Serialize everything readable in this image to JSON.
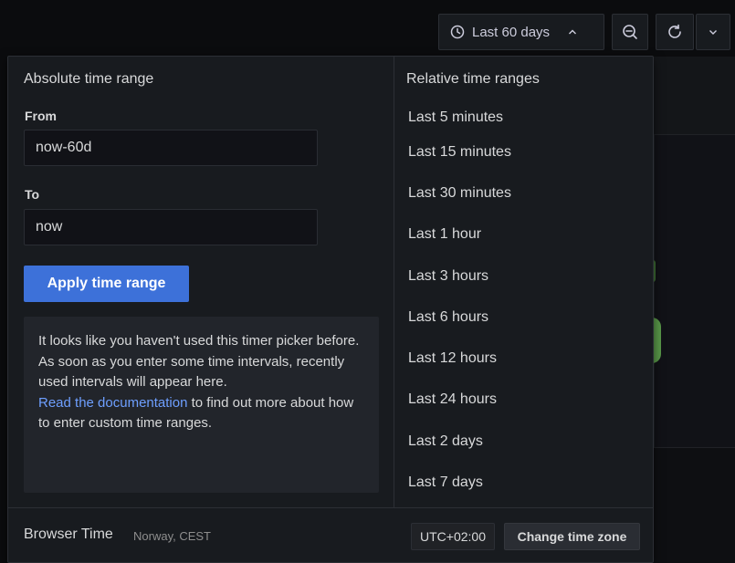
{
  "toolbar": {
    "time_range_label": "Last 60 days",
    "icons": {
      "clock": "clock-icon",
      "caret": "chevron-up-icon",
      "zoom": "zoom-out-icon",
      "refresh": "refresh-icon",
      "refresh_more": "chevron-down-icon"
    }
  },
  "absolute": {
    "title": "Absolute time range",
    "from_label": "From",
    "from_value": "now-60d",
    "to_label": "To",
    "to_value": "now",
    "apply_label": "Apply time range"
  },
  "info": {
    "text": "It looks like you haven't used this timer picker before. As soon as you enter some time intervals, recently used intervals will appear here.",
    "link_text": "Read the documentation",
    "link_suffix": " to find out more about how to enter custom time ranges."
  },
  "relative": {
    "title": "Relative time ranges",
    "items": [
      "Last 5 minutes",
      "Last 15 minutes",
      "Last 30 minutes",
      "Last 1 hour",
      "Last 3 hours",
      "Last 6 hours",
      "Last 12 hours",
      "Last 24 hours",
      "Last 2 days",
      "Last 7 days"
    ]
  },
  "footer": {
    "tz_name": "Browser Time",
    "tz_region": "Norway, CEST",
    "tz_offset": "UTC+02:00",
    "change_label": "Change time zone"
  },
  "colors": {
    "primary": "#3d71d9",
    "link": "#6e9fff",
    "background": "#181b1f"
  }
}
